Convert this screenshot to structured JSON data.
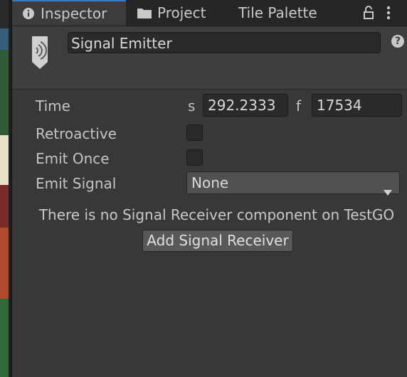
{
  "tabs": [
    {
      "label": "Inspector",
      "icon": "info-icon",
      "active": true
    },
    {
      "label": "Project",
      "icon": "folder-icon",
      "active": false
    },
    {
      "label": "Tile Palette",
      "active": false
    }
  ],
  "header": {
    "icon": "signal-emitter-icon",
    "name": "Signal Emitter"
  },
  "fields": {
    "time_label": "Time",
    "time_seconds_unit": "s",
    "time_seconds_value": "292.2333",
    "time_frames_unit": "f",
    "time_frames_value": "17534",
    "retroactive_label": "Retroactive",
    "emit_once_label": "Emit Once",
    "emit_signal_label": "Emit Signal",
    "emit_signal_value": "None"
  },
  "message": "There is no Signal Receiver component on TestGO",
  "add_button_label": "Add Signal Receiver",
  "colors": {
    "accent": "#3a79bb",
    "background": "#383838",
    "field": "#2a2a2a"
  }
}
